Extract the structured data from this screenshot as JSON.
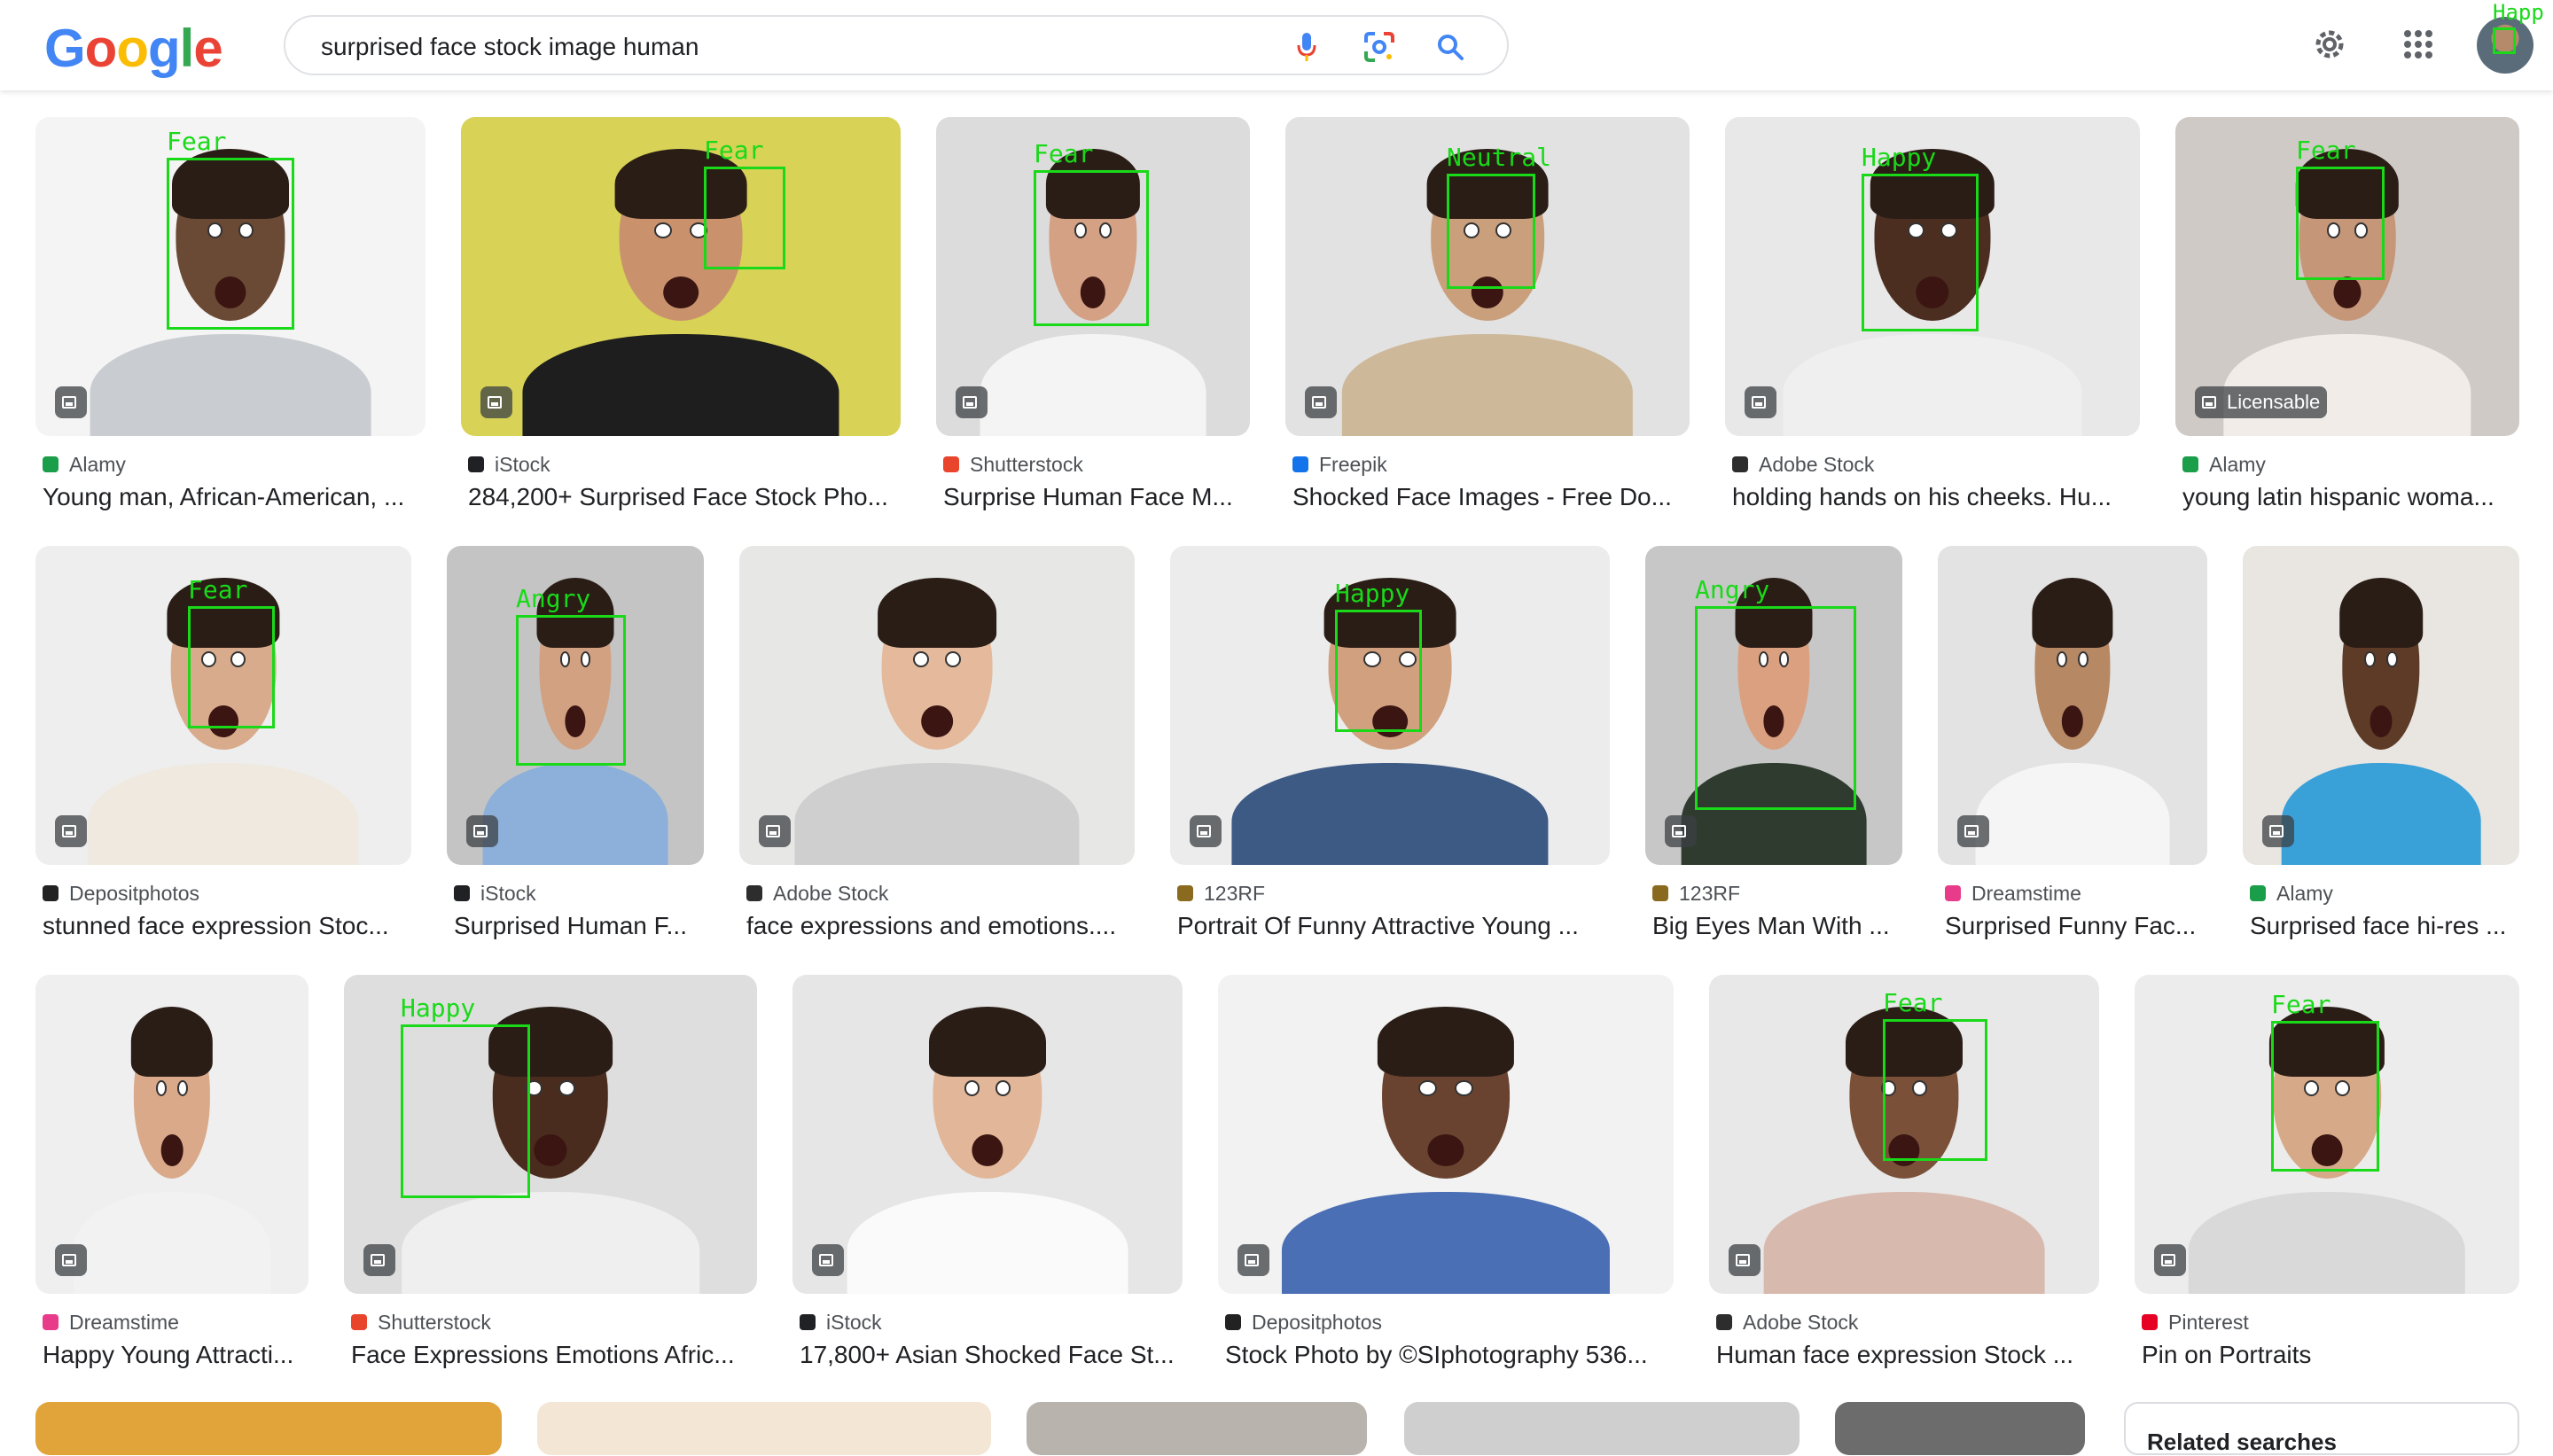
{
  "header": {
    "logo_letters": [
      "G",
      "o",
      "o",
      "g",
      "l",
      "e"
    ],
    "logo_colors": [
      "#4285F4",
      "#EA4335",
      "#FBBC05",
      "#4285F4",
      "#34A853",
      "#EA4335"
    ],
    "search_query": "surprised face stock image human",
    "avatar_label": "Happ"
  },
  "results": [
    {
      "source": "Alamy",
      "title": "Young man, African-American, ...",
      "emotion": "Fear",
      "badge": ""
    },
    {
      "source": "iStock",
      "title": "284,200+ Surprised Face Stock Pho...",
      "emotion": "Fear",
      "badge": ""
    },
    {
      "source": "Shutterstock",
      "title": "Surprise Human Face M...",
      "emotion": "Fear",
      "badge": ""
    },
    {
      "source": "Freepik",
      "title": "Shocked Face Images - Free Do...",
      "emotion": "Neutral",
      "badge": ""
    },
    {
      "source": "Adobe Stock",
      "title": "holding hands on his cheeks. Hu...",
      "emotion": "Happy",
      "badge": ""
    },
    {
      "source": "Alamy",
      "title": "young latin hispanic woma...",
      "emotion": "Fear",
      "badge": "Licensable"
    },
    {
      "source": "Depositphotos",
      "title": "stunned face expression Stoc...",
      "emotion": "Fear",
      "badge": ""
    },
    {
      "source": "iStock",
      "title": "Surprised Human F...",
      "emotion": "Angry",
      "badge": ""
    },
    {
      "source": "Adobe Stock",
      "title": "face expressions and emotions....",
      "emotion": "",
      "badge": ""
    },
    {
      "source": "123RF",
      "title": "Portrait Of Funny Attractive Young ...",
      "emotion": "Happy",
      "badge": ""
    },
    {
      "source": "123RF",
      "title": "Big Eyes Man With ...",
      "emotion": "Angry",
      "badge": ""
    },
    {
      "source": "Dreamstime",
      "title": "Surprised Funny Fac...",
      "emotion": "",
      "badge": ""
    },
    {
      "source": "Alamy",
      "title": "Surprised face hi-res ...",
      "emotion": "",
      "badge": ""
    },
    {
      "source": "Dreamstime",
      "title": "Happy Young Attracti...",
      "emotion": "",
      "badge": ""
    },
    {
      "source": "Shutterstock",
      "title": "Face Expressions Emotions Afric...",
      "emotion": "Happy",
      "badge": ""
    },
    {
      "source": "iStock",
      "title": "17,800+ Asian Shocked Face St...",
      "emotion": "",
      "badge": ""
    },
    {
      "source": "Depositphotos",
      "title": "Stock Photo by ©SIphotography 536...",
      "emotion": "",
      "badge": ""
    },
    {
      "source": "Adobe Stock",
      "title": "Human face expression Stock ...",
      "emotion": "Fear",
      "badge": ""
    },
    {
      "source": "Pinterest",
      "title": "Pin on Portraits",
      "emotion": "Fear",
      "badge": ""
    }
  ],
  "source_colors": {
    "Alamy": "#1a9e4a",
    "iStock": "#202124",
    "Shutterstock": "#e8452c",
    "Freepik": "#1273eb",
    "Adobe Stock": "#2d2d2d",
    "Depositphotos": "#222222",
    "123RF": "#8a6a1f",
    "Dreamstime": "#e83c8b",
    "Pinterest": "#e60023"
  },
  "related_panel_title": "Related searches"
}
